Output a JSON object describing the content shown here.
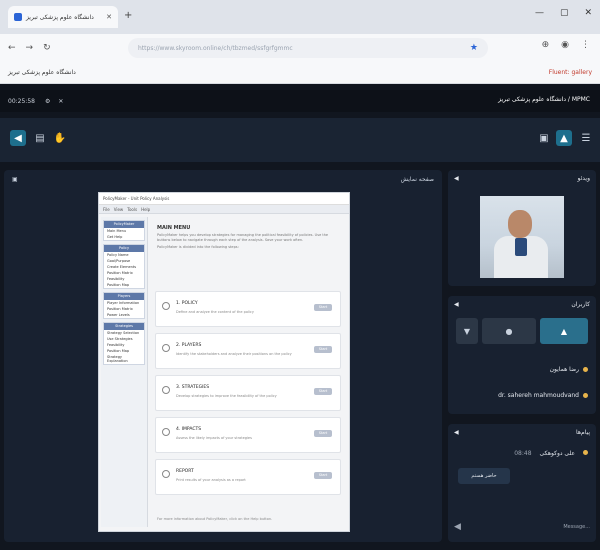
{
  "browser": {
    "tab_title": "دانشگاه علوم پزشکی تبریز",
    "url": "https://www.skyroom.online/ch/tbzmed/ssfgrfgmmc",
    "bookmark_left": "دانشگاه علوم پزشکی تبریز",
    "bookmark_right": "Fluent: gallery"
  },
  "app": {
    "time": "00:25:58",
    "title": "دانشگاه علوم پزشکی تبریز / MPMC"
  },
  "stage": {
    "header_label": "صفحه نمایش"
  },
  "shared_screen": {
    "window_title": "PolicyMaker - Unit Policy Analysis",
    "menu": [
      "File",
      "View",
      "Tools",
      "Help"
    ],
    "sidebar_groups": [
      {
        "title": "PolicyMaker",
        "items": [
          "Main Menu",
          "Get Help"
        ]
      },
      {
        "title": "Policy",
        "items": [
          "Policy Name",
          "Goal/Purpose",
          "Create Elements",
          "Position Matrix",
          "Feasibility",
          "Position Map"
        ]
      },
      {
        "title": "Players",
        "items": [
          "Player Information",
          "Position Matrix",
          "Power Levels"
        ]
      },
      {
        "title": "Strategies",
        "items": [
          "Strategy Selection",
          "Use Strategies",
          "Feasibility",
          "Position Map",
          "Strategy Explanation"
        ]
      }
    ],
    "heading": "MAIN MENU",
    "intro": "PolicyMaker helps you develop strategies for managing the political feasibility of policies. Use the buttons below to navigate through each step of the analysis. Save your work often.",
    "intro2": "PolicyMaker is divided into the following steps:",
    "cards": [
      {
        "title": "1. POLICY",
        "desc": "Define and analyze the content of the policy",
        "btn": "Start"
      },
      {
        "title": "2. PLAYERS",
        "desc": "Identify the stakeholders and analyze their positions on the policy",
        "btn": "Start"
      },
      {
        "title": "3. STRATEGIES",
        "desc": "Develop strategies to improve the feasibility of the policy",
        "btn": "Start"
      },
      {
        "title": "4. IMPACTS",
        "desc": "Assess the likely impacts of your strategies",
        "btn": "Start"
      },
      {
        "title": "REPORT",
        "desc": "Print results of your analysis as a report",
        "btn": "Start"
      }
    ],
    "footer": "For more information about PolicyMaker, click on the Help button."
  },
  "video_panel": {
    "label": "ویدئو"
  },
  "users_panel": {
    "label": "کاربران",
    "users": [
      "رضا همایون",
      "dr. sahereh mahmoudvand"
    ]
  },
  "chat_panel": {
    "label": "پیام‌ها",
    "msg_name": "علی دوکوهکی",
    "msg_time": "08:48",
    "bubble": "حاضر هستم",
    "input_placeholder": "Message..."
  }
}
